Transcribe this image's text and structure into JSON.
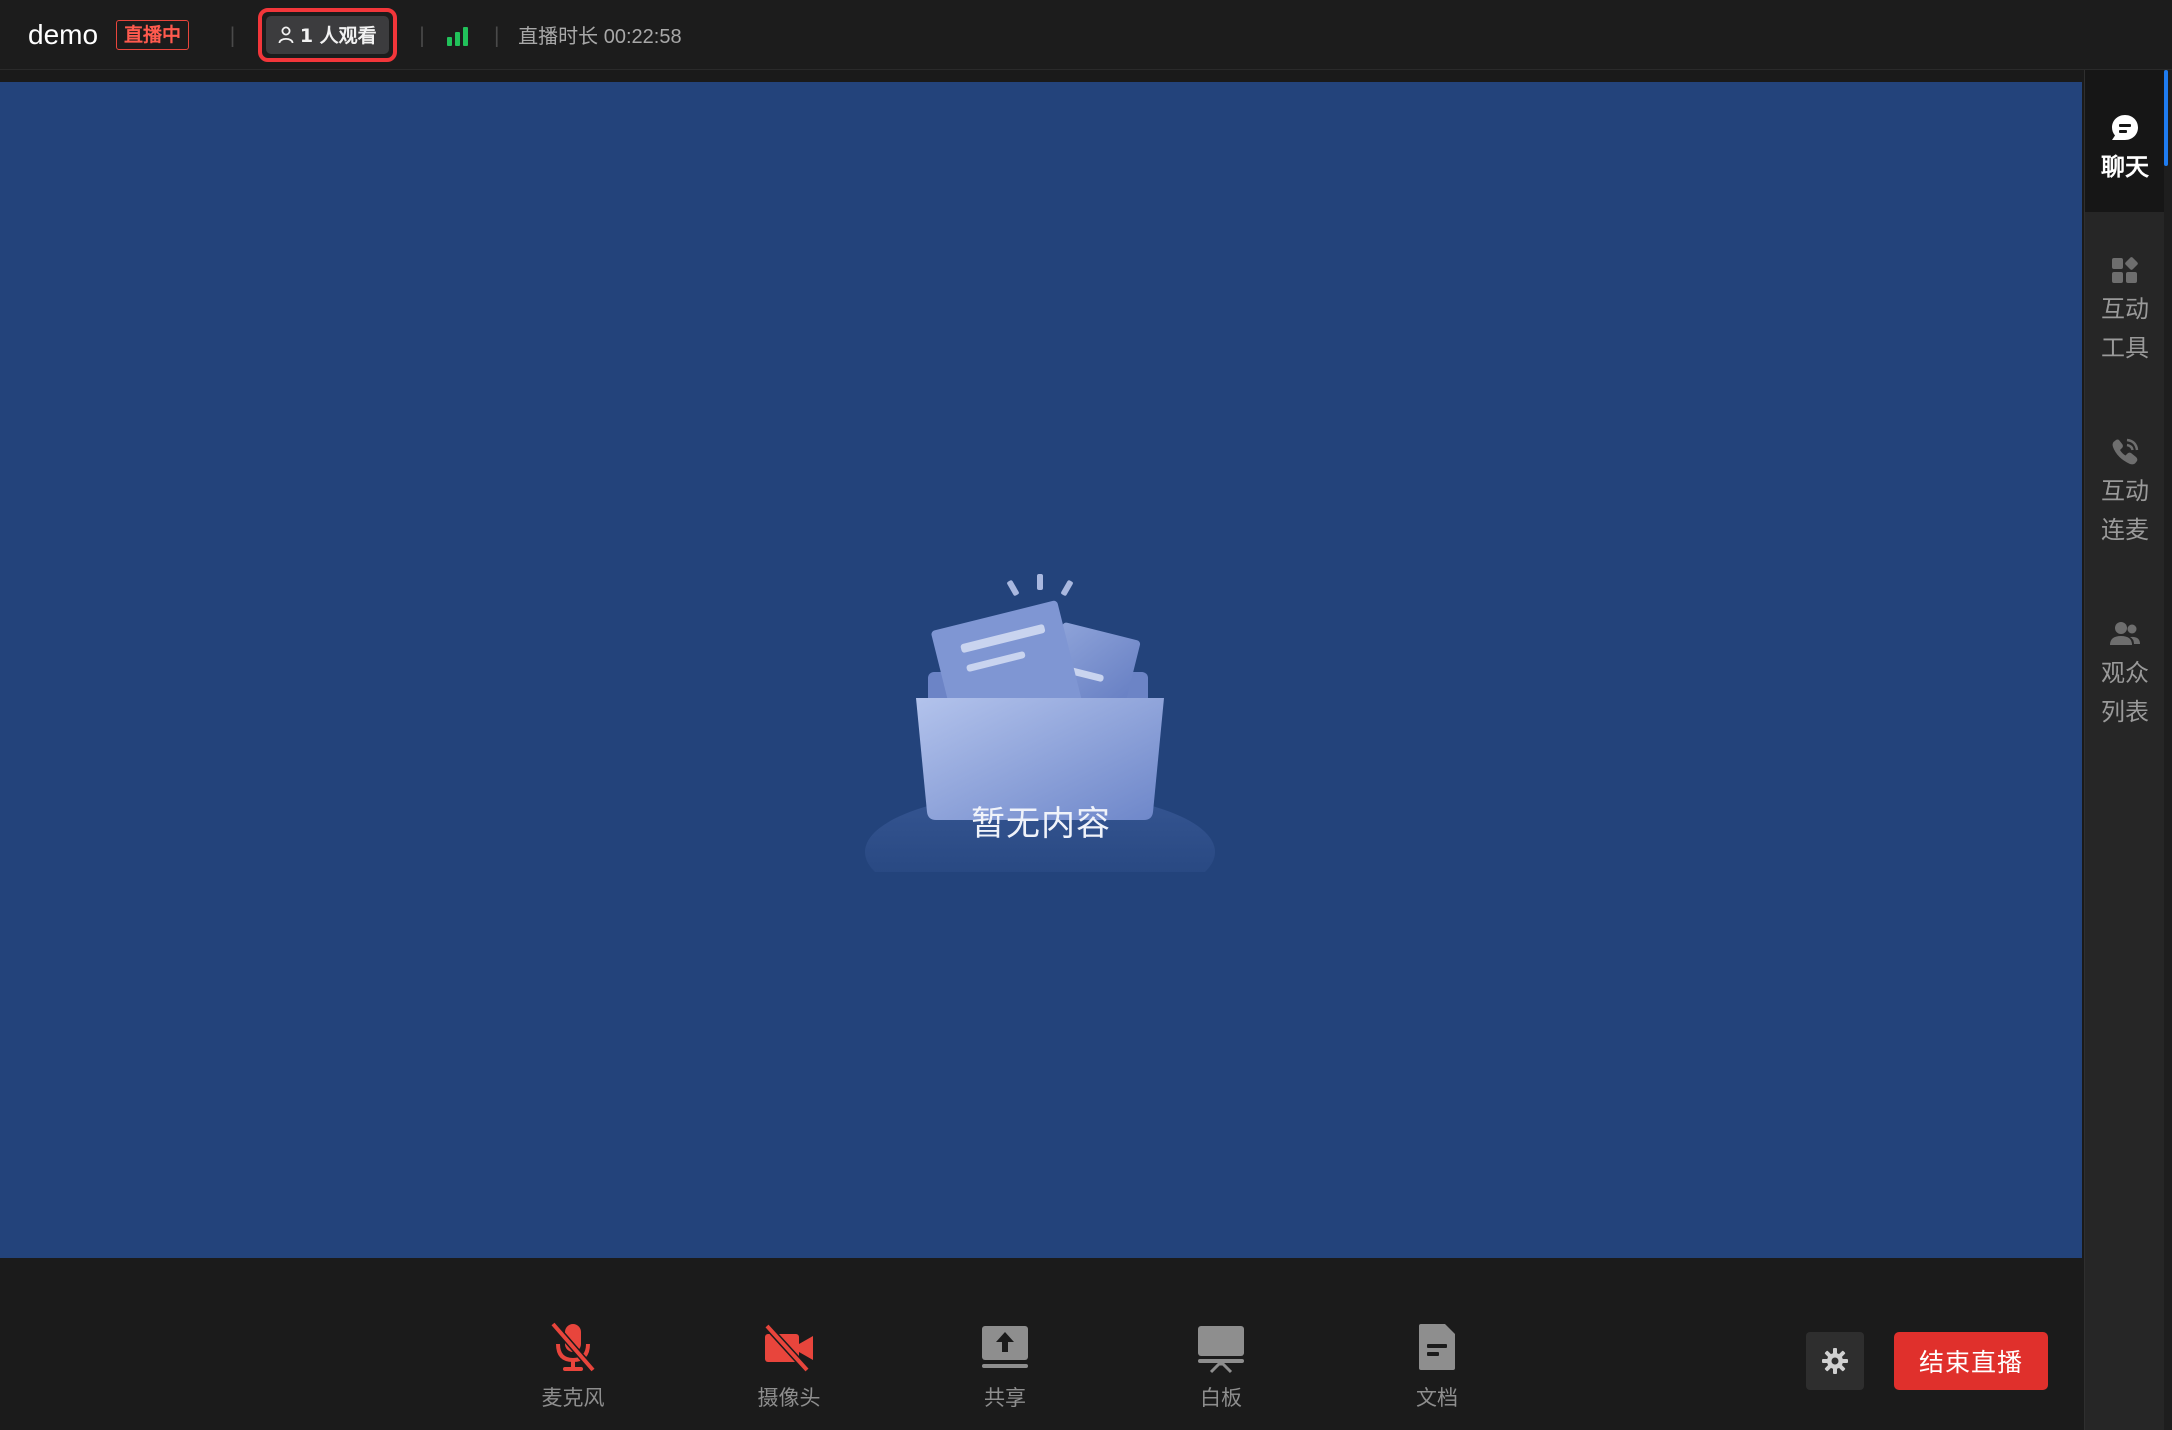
{
  "header": {
    "title": "demo",
    "live_status": "直播中",
    "viewer_count": "1 人观看",
    "duration_label": "直播时长",
    "duration": "00:22:58"
  },
  "stage": {
    "empty_text": "暂无内容"
  },
  "toolbar": {
    "mic_label": "麦克风",
    "camera_label": "摄像头",
    "share_label": "共享",
    "whiteboard_label": "白板",
    "doc_label": "文档",
    "end_label": "结束直播"
  },
  "sidebar": {
    "items": [
      {
        "label": "聊天",
        "icon": "chat-icon",
        "active": true
      },
      {
        "label": "互动\n工具",
        "icon": "apps-icon",
        "active": false
      },
      {
        "label": "互动\n连麦",
        "icon": "phone-icon",
        "active": false
      },
      {
        "label": "观众\n列表",
        "icon": "people-icon",
        "active": false
      }
    ]
  },
  "colors": {
    "stage_bg": "#23437b",
    "live_red": "#e8453c",
    "end_red": "#e0302c",
    "signal_green": "#21c15a",
    "accent_blue": "#1f7cf0",
    "muted_red_icon": "#e8453c"
  }
}
